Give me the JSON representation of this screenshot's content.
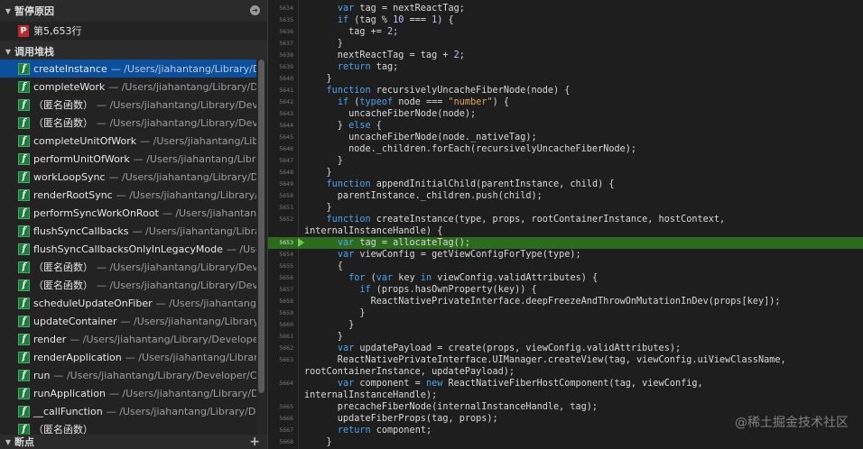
{
  "sidebar": {
    "pause_header": "暂停原因",
    "pause_icon_letter": "P",
    "pause_reason": "第5,653行",
    "stack_header": "调用堆栈",
    "breakpoints_header": "断点",
    "frames": [
      {
        "name": "createInstance",
        "path": "— /Users/jiahantang/Library/Developer"
      },
      {
        "name": "completeWork",
        "path": "— /Users/jiahantang/Library/Developer"
      },
      {
        "name": "（匿名函数）",
        "path": "— /Users/jiahantang/Library/Developer"
      },
      {
        "name": "（匿名函数）",
        "path": "— /Users/jiahantang/Library/Developer"
      },
      {
        "name": "completeUnitOfWork",
        "path": "— /Users/jiahantang/Library/Developer"
      },
      {
        "name": "performUnitOfWork",
        "path": "— /Users/jiahantang/Library/Developer"
      },
      {
        "name": "workLoopSync",
        "path": "— /Users/jiahantang/Library/Developer"
      },
      {
        "name": "renderRootSync",
        "path": "— /Users/jiahantang/Library/Developer"
      },
      {
        "name": "performSyncWorkOnRoot",
        "path": "— /Users/jiahantang/Library/Developer"
      },
      {
        "name": "flushSyncCallbacks",
        "path": "— /Users/jiahantang/Library/Developer"
      },
      {
        "name": "flushSyncCallbacksOnlyInLegacyMode",
        "path": "— /Users/jiahantang/Library/Developer"
      },
      {
        "name": "（匿名函数）",
        "path": "— /Users/jiahantang/Library/Developer"
      },
      {
        "name": "（匿名函数）",
        "path": "— /Users/jiahantang/Library/Developer"
      },
      {
        "name": "scheduleUpdateOnFiber",
        "path": "— /Users/jiahantang/Library/Developer"
      },
      {
        "name": "updateContainer",
        "path": "— /Users/jiahantang/Library/Developer"
      },
      {
        "name": "render",
        "path": "— /Users/jiahantang/Library/Developer/Core"
      },
      {
        "name": "renderApplication",
        "path": "— /Users/jiahantang/Library/Developer"
      },
      {
        "name": "run",
        "path": "— /Users/jiahantang/Library/Developer/Core"
      },
      {
        "name": "runApplication",
        "path": "— /Users/jiahantang/Library/Developer"
      },
      {
        "name": "__callFunction",
        "path": "— /Users/jiahantang/Library/Developer"
      },
      {
        "name": "（匿名函数）",
        "path": ""
      }
    ]
  },
  "editor": {
    "lines": [
      {
        "n": "5634",
        "code": "      var tag = nextReactTag;"
      },
      {
        "n": "5635",
        "code": "      if (tag % 10 === 1) {"
      },
      {
        "n": "5636",
        "code": "        tag += 2;"
      },
      {
        "n": "5637",
        "code": "      }"
      },
      {
        "n": "5638",
        "code": "      nextReactTag = tag + 2;"
      },
      {
        "n": "5639",
        "code": "      return tag;"
      },
      {
        "n": "5640",
        "code": "    }"
      },
      {
        "n": "5641",
        "code": "    function recursivelyUncacheFiberNode(node) {"
      },
      {
        "n": "5642",
        "code": "      if (typeof node === \"number\") {"
      },
      {
        "n": "5643",
        "code": "        uncacheFiberNode(node);"
      },
      {
        "n": "5644",
        "code": "      } else {"
      },
      {
        "n": "5645",
        "code": "        uncacheFiberNode(node._nativeTag);"
      },
      {
        "n": "5646",
        "code": "        node._children.forEach(recursivelyUncacheFiberNode);"
      },
      {
        "n": "5647",
        "code": "      }"
      },
      {
        "n": "5648",
        "code": "    }"
      },
      {
        "n": "5649",
        "code": "    function appendInitialChild(parentInstance, child) {"
      },
      {
        "n": "5650",
        "code": "      parentInstance._children.push(child);"
      },
      {
        "n": "5651",
        "code": "    }"
      },
      {
        "n": "5652",
        "code": "    function createInstance(type, props, rootContainerInstance, hostContext,"
      },
      {
        "n": "",
        "code": "internalInstanceHandle) {"
      },
      {
        "n": "5653",
        "code": "      var tag = allocateTag();"
      },
      {
        "n": "5654",
        "code": "      var viewConfig = getViewConfigForType(type);"
      },
      {
        "n": "5655",
        "code": "      {"
      },
      {
        "n": "5656",
        "code": "        for (var key in viewConfig.validAttributes) {"
      },
      {
        "n": "5657",
        "code": "          if (props.hasOwnProperty(key)) {"
      },
      {
        "n": "5658",
        "code": "            ReactNativePrivateInterface.deepFreezeAndThrowOnMutationInDev(props[key]);"
      },
      {
        "n": "5659",
        "code": "          }"
      },
      {
        "n": "5660",
        "code": "        }"
      },
      {
        "n": "5661",
        "code": "      }"
      },
      {
        "n": "5662",
        "code": "      var updatePayload = create(props, viewConfig.validAttributes);"
      },
      {
        "n": "5663",
        "code": "      ReactNativePrivateInterface.UIManager.createView(tag, viewConfig.uiViewClassName,"
      },
      {
        "n": "",
        "code": "rootContainerInstance, updatePayload);"
      },
      {
        "n": "5664",
        "code": "      var component = new ReactNativeFiberHostComponent(tag, viewConfig,"
      },
      {
        "n": "",
        "code": "internalInstanceHandle);"
      },
      {
        "n": "5665",
        "code": "      precacheFiberNode(internalInstanceHandle, tag);"
      },
      {
        "n": "5666",
        "code": "      updateFiberProps(tag, props);"
      },
      {
        "n": "5667",
        "code": "      return component;"
      },
      {
        "n": "5668",
        "code": "    }"
      }
    ],
    "highlight_line": "5653"
  },
  "watermark": "@稀土掘金技术社区",
  "colors": {
    "keyword": "#4aa4ee",
    "string": "#e0a458",
    "number": "#c7b9ff",
    "current_line": "#2c6b1d",
    "selected_frame": "#0c4f9b",
    "pause_icon": "#c1272d",
    "function_icon": "#1a7d3a"
  }
}
